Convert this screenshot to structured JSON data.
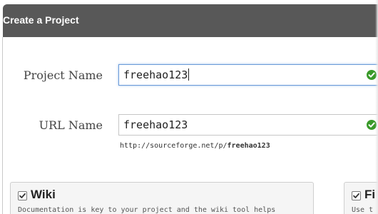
{
  "dialog": {
    "title": "Create a Project"
  },
  "form": {
    "project_name": {
      "label": "Project Name",
      "value": "freehao123",
      "valid_icon": "check-circle-icon"
    },
    "url_name": {
      "label": "URL Name",
      "value": "freehao123",
      "valid_icon": "check-circle-icon",
      "hint_prefix": "http://sourceforge.net/p/",
      "hint_slug": "freehao123"
    }
  },
  "tools": [
    {
      "title": "Wiki",
      "checked": true,
      "description": "Documentation is key to your project and the wiki tool helps"
    },
    {
      "title": "Fi",
      "checked": true,
      "description": "Use t"
    }
  ],
  "colors": {
    "header_bg": "#585858",
    "valid_green": "#3a9a2a",
    "focus_border": "#6b9bd8"
  }
}
